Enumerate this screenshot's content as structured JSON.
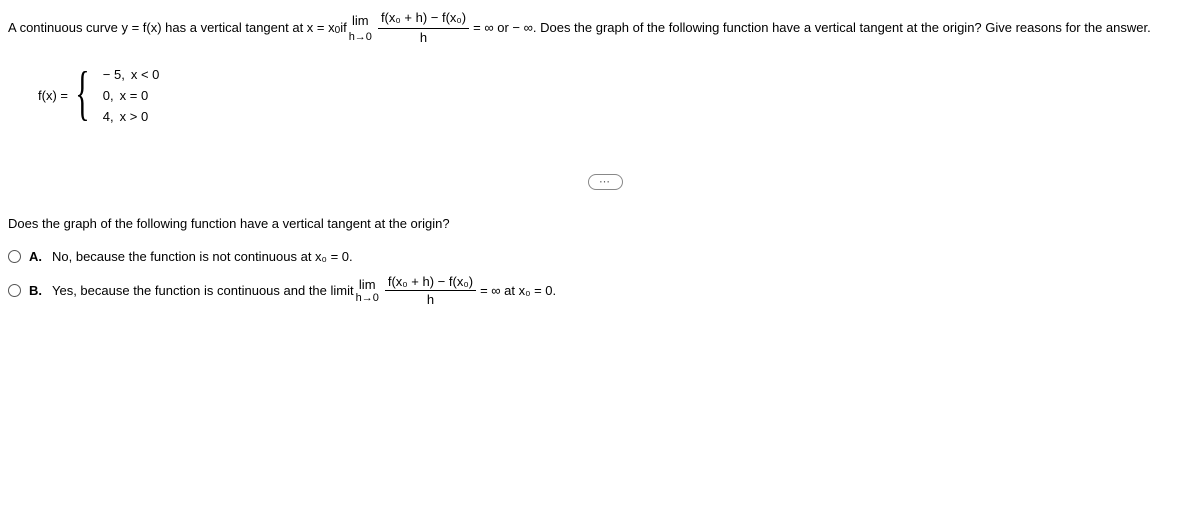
{
  "intro": {
    "part1": "A continuous curve y = f(x) has a vertical tangent at x = x",
    "sub0a": "0",
    "part2": " if ",
    "lim_top": "lim",
    "lim_bot": "h→0",
    "frac_num": "f(x₀ + h) − f(x₀)",
    "frac_den": "h",
    "part3": " = ∞ or − ∞. Does the graph of the following function have a vertical tangent at the origin? Give reasons for the answer."
  },
  "piecewise": {
    "lhs": "f(x) = ",
    "cases": [
      {
        "val": "− 5,",
        "cond": "x < 0"
      },
      {
        "val": "0,",
        "cond": "x = 0"
      },
      {
        "val": "4,",
        "cond": "x > 0"
      }
    ]
  },
  "ellipsis": "⋯",
  "question": "Does the graph of the following function have a vertical tangent at the origin?",
  "options": {
    "A": {
      "label": "A.",
      "text": "No, because the function is not continuous at x₀ = 0."
    },
    "B": {
      "label": "B.",
      "pre": "Yes, because the function is continuous and the limit ",
      "lim_top": "lim",
      "lim_bot": "h→0",
      "frac_num": "f(x₀ + h) − f(x₀)",
      "frac_den": "h",
      "post": " = ∞ at x₀ = 0."
    }
  }
}
